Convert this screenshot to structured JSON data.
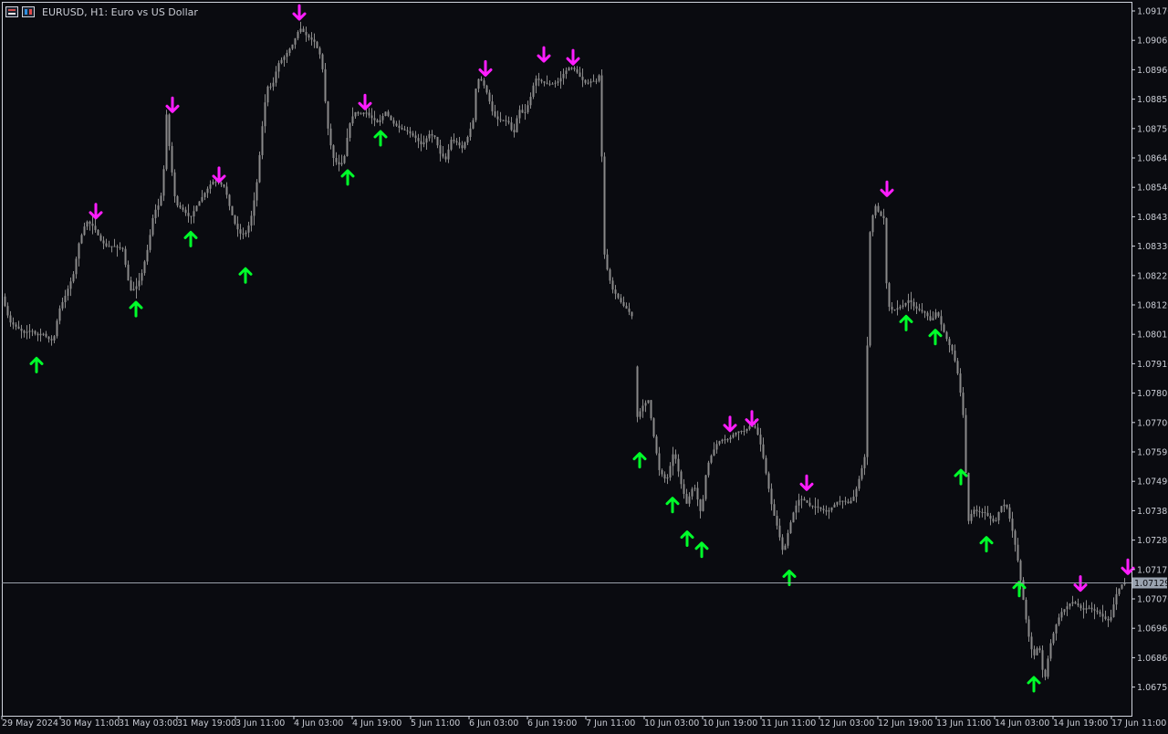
{
  "window": {
    "title": "EURUSD, H1:  Euro vs US Dollar",
    "symbol_icon": "chart-properties-icon",
    "flag_icon": "symbol-flag-icon"
  },
  "colors": {
    "background": "#0a0b10",
    "candles": "#8a8a8a",
    "up_arrow": "#00ff2a",
    "down_arrow": "#ff1dff",
    "axis_text": "#c9ccd4",
    "price_line": "#9aa0aa"
  },
  "current_price": "1.07129",
  "chart_data": {
    "type": "candlestick",
    "title": "EURUSD, H1:  Euro vs US Dollar",
    "y_ticks": [
      "1.09170",
      "1.09065",
      "1.08960",
      "1.08855",
      "1.08750",
      "1.08645",
      "1.08540",
      "1.08435",
      "1.08330",
      "1.08225",
      "1.08120",
      "1.08015",
      "1.07910",
      "1.07805",
      "1.07700",
      "1.07595",
      "1.07490",
      "1.07385",
      "1.07280",
      "1.07175",
      "1.07070",
      "1.06965",
      "1.06860",
      "1.06755"
    ],
    "x_ticks": [
      "29 May 2024",
      "30 May 11:00",
      "31 May 03:00",
      "31 May 19:00",
      "3 Jun 11:00",
      "4 Jun 03:00",
      "4 Jun 19:00",
      "5 Jun 11:00",
      "6 Jun 03:00",
      "6 Jun 19:00",
      "7 Jun 11:00",
      "10 Jun 03:00",
      "10 Jun 19:00",
      "11 Jun 11:00",
      "12 Jun 03:00",
      "12 Jun 19:00",
      "13 Jun 11:00",
      "14 Jun 03:00",
      "14 Jun 19:00",
      "17 Jun 11:00"
    ],
    "ylim": [
      1.0672,
      1.0919
    ],
    "grid": false,
    "price_line": 1.07129,
    "path": [
      [
        0,
        1.0815
      ],
      [
        8,
        1.0806
      ],
      [
        16,
        1.0804
      ],
      [
        24,
        1.0802
      ],
      [
        32,
        1.0803
      ],
      [
        38,
        1.0801
      ],
      [
        44,
        1.0802
      ],
      [
        50,
        1.08
      ],
      [
        56,
        1.0799
      ],
      [
        62,
        1.081
      ],
      [
        70,
        1.0816
      ],
      [
        78,
        1.0823
      ],
      [
        84,
        1.0834
      ],
      [
        92,
        1.0842
      ],
      [
        100,
        1.084
      ],
      [
        108,
        1.0835
      ],
      [
        114,
        1.0833
      ],
      [
        122,
        1.0833
      ],
      [
        132,
        1.0832
      ],
      [
        140,
        1.0817
      ],
      [
        146,
        1.0818
      ],
      [
        152,
        1.0822
      ],
      [
        160,
        1.0833
      ],
      [
        166,
        1.0845
      ],
      [
        172,
        1.0848
      ],
      [
        176,
        1.0854
      ],
      [
        180,
        1.088
      ],
      [
        184,
        1.0865
      ],
      [
        190,
        1.0848
      ],
      [
        198,
        1.0846
      ],
      [
        206,
        1.0843
      ],
      [
        214,
        1.0848
      ],
      [
        222,
        1.0852
      ],
      [
        230,
        1.0856
      ],
      [
        236,
        1.0856
      ],
      [
        244,
        1.0854
      ],
      [
        250,
        1.0846
      ],
      [
        256,
        1.084
      ],
      [
        262,
        1.0837
      ],
      [
        268,
        1.0838
      ],
      [
        274,
        1.0845
      ],
      [
        280,
        1.0858
      ],
      [
        284,
        1.0873
      ],
      [
        290,
        1.089
      ],
      [
        296,
        1.089
      ],
      [
        302,
        1.0898
      ],
      [
        310,
        1.0901
      ],
      [
        318,
        1.0905
      ],
      [
        326,
        1.0911
      ],
      [
        334,
        1.0908
      ],
      [
        342,
        1.0906
      ],
      [
        350,
        1.09
      ],
      [
        356,
        1.0877
      ],
      [
        362,
        1.0865
      ],
      [
        368,
        1.0862
      ],
      [
        374,
        1.0863
      ],
      [
        380,
        1.0876
      ],
      [
        386,
        1.0881
      ],
      [
        392,
        1.088
      ],
      [
        398,
        1.0881
      ],
      [
        404,
        1.0879
      ],
      [
        412,
        1.0877
      ],
      [
        420,
        1.0881
      ],
      [
        428,
        1.0877
      ],
      [
        436,
        1.0875
      ],
      [
        444,
        1.0874
      ],
      [
        452,
        1.0872
      ],
      [
        460,
        1.0869
      ],
      [
        468,
        1.0873
      ],
      [
        474,
        1.0872
      ],
      [
        480,
        1.0866
      ],
      [
        486,
        1.0864
      ],
      [
        492,
        1.0871
      ],
      [
        498,
        1.087
      ],
      [
        504,
        1.0868
      ],
      [
        510,
        1.0872
      ],
      [
        516,
        1.0878
      ],
      [
        520,
        1.0893
      ],
      [
        526,
        1.0892
      ],
      [
        532,
        1.0887
      ],
      [
        538,
        1.088
      ],
      [
        544,
        1.0878
      ],
      [
        550,
        1.0878
      ],
      [
        556,
        1.0877
      ],
      [
        560,
        1.0872
      ],
      [
        566,
        1.0882
      ],
      [
        572,
        1.088
      ],
      [
        578,
        1.0885
      ],
      [
        584,
        1.0893
      ],
      [
        590,
        1.0892
      ],
      [
        596,
        1.0891
      ],
      [
        604,
        1.0891
      ],
      [
        610,
        1.0892
      ],
      [
        616,
        1.0895
      ],
      [
        622,
        1.0897
      ],
      [
        628,
        1.0896
      ],
      [
        634,
        1.0893
      ],
      [
        640,
        1.0891
      ],
      [
        646,
        1.0892
      ],
      [
        652,
        1.0892
      ],
      [
        656,
        1.0896
      ],
      [
        658,
        1.0834
      ],
      [
        662,
        1.0826
      ],
      [
        668,
        1.0818
      ],
      [
        674,
        1.0815
      ],
      [
        680,
        1.0812
      ],
      [
        686,
        1.081
      ],
      [
        690,
        1.0808
      ],
      [
        696,
        1.0772
      ],
      [
        702,
        1.0776
      ],
      [
        708,
        1.0778
      ],
      [
        714,
        1.0765
      ],
      [
        720,
        1.0753
      ],
      [
        728,
        1.0749
      ],
      [
        736,
        1.076
      ],
      [
        744,
        1.0748
      ],
      [
        750,
        1.0741
      ],
      [
        758,
        1.0748
      ],
      [
        766,
        1.0737
      ],
      [
        772,
        1.0754
      ],
      [
        778,
        1.0759
      ],
      [
        784,
        1.0763
      ],
      [
        790,
        1.0764
      ],
      [
        796,
        1.0764
      ],
      [
        802,
        1.0766
      ],
      [
        808,
        1.0767
      ],
      [
        814,
        1.0767
      ],
      [
        820,
        1.0769
      ],
      [
        826,
        1.0768
      ],
      [
        832,
        1.0761
      ],
      [
        838,
        1.075
      ],
      [
        844,
        1.0739
      ],
      [
        850,
        1.0732
      ],
      [
        856,
        1.0723
      ],
      [
        862,
        1.0732
      ],
      [
        868,
        1.0739
      ],
      [
        874,
        1.0743
      ],
      [
        880,
        1.0742
      ],
      [
        886,
        1.074
      ],
      [
        892,
        1.074
      ],
      [
        898,
        1.0739
      ],
      [
        904,
        1.0738
      ],
      [
        910,
        1.074
      ],
      [
        916,
        1.0742
      ],
      [
        922,
        1.0742
      ],
      [
        928,
        1.0741
      ],
      [
        934,
        1.0744
      ],
      [
        940,
        1.0751
      ],
      [
        946,
        1.0759
      ],
      [
        950,
        1.0836
      ],
      [
        956,
        1.0848
      ],
      [
        962,
        1.0844
      ],
      [
        966,
        1.0843
      ],
      [
        970,
        1.0812
      ],
      [
        976,
        1.081
      ],
      [
        982,
        1.0811
      ],
      [
        988,
        1.0812
      ],
      [
        994,
        1.0814
      ],
      [
        1000,
        1.0811
      ],
      [
        1006,
        1.081
      ],
      [
        1012,
        1.0809
      ],
      [
        1018,
        1.0806
      ],
      [
        1024,
        1.081
      ],
      [
        1030,
        1.0804
      ],
      [
        1036,
        1.0799
      ],
      [
        1042,
        1.0795
      ],
      [
        1048,
        1.0786
      ],
      [
        1054,
        1.077
      ],
      [
        1058,
        1.0734
      ],
      [
        1064,
        1.0739
      ],
      [
        1070,
        1.0738
      ],
      [
        1076,
        1.0738
      ],
      [
        1082,
        1.0736
      ],
      [
        1088,
        1.0734
      ],
      [
        1094,
        1.074
      ],
      [
        1100,
        1.0741
      ],
      [
        1106,
        1.0733
      ],
      [
        1112,
        1.0723
      ],
      [
        1118,
        1.0709
      ],
      [
        1124,
        1.0695
      ],
      [
        1130,
        1.0686
      ],
      [
        1136,
        1.0691
      ],
      [
        1142,
        1.0677
      ],
      [
        1148,
        1.069
      ],
      [
        1154,
        1.0697
      ],
      [
        1160,
        1.0702
      ],
      [
        1166,
        1.0704
      ],
      [
        1172,
        1.0706
      ],
      [
        1178,
        1.0705
      ],
      [
        1184,
        1.0703
      ],
      [
        1190,
        1.0704
      ],
      [
        1196,
        1.0703
      ],
      [
        1202,
        1.0702
      ],
      [
        1208,
        1.07
      ],
      [
        1214,
        1.0699
      ],
      [
        1220,
        1.0708
      ],
      [
        1226,
        1.0712
      ],
      [
        1232,
        1.0713
      ]
    ],
    "gaps": [
      [
        692,
        694
      ]
    ],
    "signals": {
      "down": [
        [
          103,
          1.0845
        ],
        [
          187,
          1.0883
        ],
        [
          238,
          1.0858
        ],
        [
          326,
          1.0916
        ],
        [
          398,
          1.0884
        ],
        [
          530,
          1.0896
        ],
        [
          594,
          1.0901
        ],
        [
          626,
          1.09
        ],
        [
          798,
          1.0769
        ],
        [
          822,
          1.0771
        ],
        [
          882,
          1.0748
        ],
        [
          970,
          1.0853
        ],
        [
          1182,
          1.0712
        ],
        [
          1234,
          1.0718
        ]
      ],
      "up": [
        [
          38,
          1.0791
        ],
        [
          147,
          1.0811
        ],
        [
          207,
          1.0836
        ],
        [
          267,
          1.0823
        ],
        [
          379,
          1.0858
        ],
        [
          415,
          1.0872
        ],
        [
          699,
          1.0757
        ],
        [
          735,
          1.0741
        ],
        [
          751,
          1.0729
        ],
        [
          767,
          1.0725
        ],
        [
          863,
          1.0715
        ],
        [
          991,
          1.0806
        ],
        [
          1023,
          1.0801
        ],
        [
          1051,
          1.0751
        ],
        [
          1079,
          1.0727
        ],
        [
          1115,
          1.0711
        ],
        [
          1131,
          1.0677
        ]
      ]
    }
  }
}
